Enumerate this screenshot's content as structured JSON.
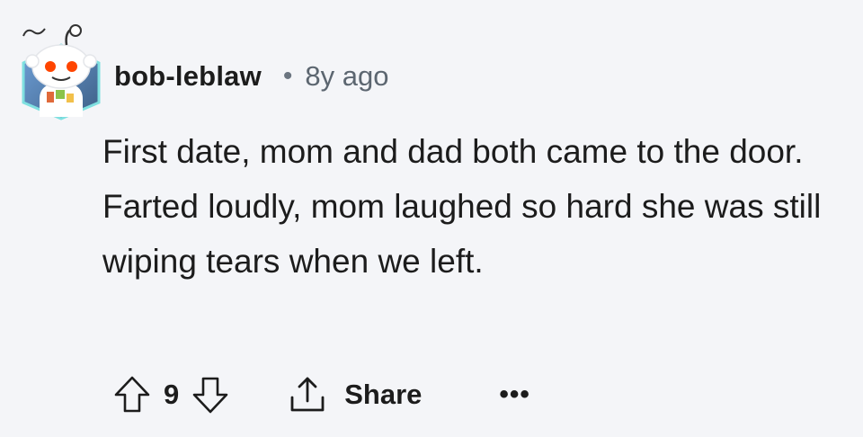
{
  "comment": {
    "avatar_icon": "snoo-avatar-icon",
    "author": "bob-leblaw",
    "separator": "•",
    "age": "8y ago",
    "body": "First date, mom and dad both came to the door. Farted loudly, mom laughed so hard she was still wiping tears when we left."
  },
  "actions": {
    "upvote_icon": "upvote-arrow-icon",
    "score": "9",
    "downvote_icon": "downvote-arrow-icon",
    "share_icon": "share-icon",
    "share_label": "Share",
    "more_label": "•••"
  },
  "colors": {
    "background": "#f4f5f8",
    "text": "#1c1c1c",
    "muted": "#5c6670",
    "avatar_badge": "#4a6a8f"
  }
}
